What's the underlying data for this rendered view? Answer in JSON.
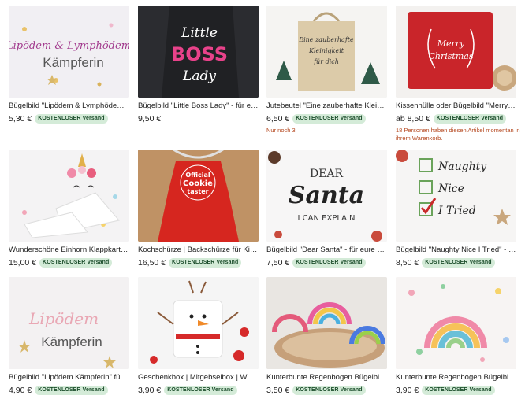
{
  "products": [
    {
      "title": "Bügelbild \"Lipödem & Lymphödem Kämpf…",
      "price": "5,30 €",
      "badge": "KOSTENLOSER Versand",
      "image_text": [
        "Lipödem & Lymphödem",
        "Kämpferin"
      ]
    },
    {
      "title": "Bügelbild \"Little Boss Lady\" - für eure klein…",
      "price": "9,50 €",
      "badge": "",
      "image_text": [
        "Little",
        "BOSS",
        "Lady"
      ]
    },
    {
      "title": "Jutebeutel \"Eine zauberhafte Kleinigkeit…",
      "price": "6,50 €",
      "badge": "KOSTENLOSER Versand",
      "note": "Nur noch 3",
      "image_text": [
        "Eine zauberhafte",
        "Kleinigkeit",
        "für dich"
      ]
    },
    {
      "title": "Kissenhülle oder Bügelbild \"Merry Christm…",
      "price": "ab 8,50 €",
      "badge": "KOSTENLOSER Versand",
      "note": "18 Personen haben diesen Artikel momentan in ihrem Warenkorb.",
      "image_text": [
        "Merry",
        "Christmas"
      ]
    },
    {
      "title": "Wunderschöne Einhorn Klappkarte Einladi…",
      "price": "15,00 €",
      "badge": "KOSTENLOSER Versand",
      "image_text": []
    },
    {
      "title": "Kochschürze | Backschürze für Kinder - Pe…",
      "price": "16,50 €",
      "badge": "KOSTENLOSER Versand",
      "image_text": [
        "Official",
        "Cookie",
        "taster"
      ]
    },
    {
      "title": "Bügelbild \"Dear Santa\" - für eure Weihnac…",
      "price": "7,50 €",
      "badge": "KOSTENLOSER Versand",
      "image_text": [
        "DEAR",
        "Santa",
        "I CAN EXPLAIN"
      ]
    },
    {
      "title": "Bügelbild \"Naughty Nice I Tried\" - für eure…",
      "price": "8,50 €",
      "badge": "KOSTENLOSER Versand",
      "image_text": [
        "Naughty",
        "Nice",
        "I Tried"
      ]
    },
    {
      "title": "Bügelbild \"Lipödem Kämpferin\" für deine T…",
      "price": "4,90 €",
      "badge": "KOSTENLOSER Versand",
      "image_text": [
        "Lipödem",
        "Kämpferin"
      ]
    },
    {
      "title": "Geschenkbox | Mitgebselbox | Weihnachts…",
      "price": "3,90 €",
      "badge": "KOSTENLOSER Versand",
      "image_text": []
    },
    {
      "title": "Kunterbunte Regenbogen Bügelbilder | B…",
      "price": "3,50 €",
      "badge": "KOSTENLOSER Versand",
      "image_text": []
    },
    {
      "title": "Kunterbunte Regenbogen Bügelbilder | B…",
      "price": "3,90 €",
      "badge": "KOSTENLOSER Versand",
      "image_text": []
    }
  ]
}
